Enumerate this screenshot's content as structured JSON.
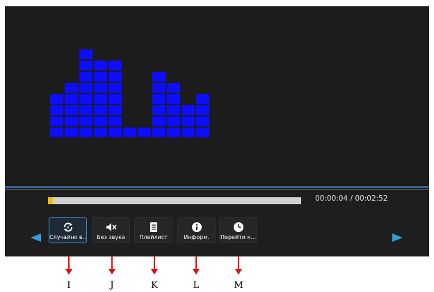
{
  "player": {
    "progress_fraction": 0.02,
    "time_text": "00:00:04 / 00:02:52",
    "equalizer_levels": [
      4,
      5,
      8,
      7,
      7,
      1,
      1,
      6,
      5,
      3,
      4
    ],
    "equalizer_color": "#0d0dff"
  },
  "buttons": [
    {
      "label": "Случайно в...",
      "icon": "shuffle-icon",
      "active": true
    },
    {
      "label": "Без звука",
      "icon": "mute-icon",
      "active": false
    },
    {
      "label": "Плейлист",
      "icon": "playlist-icon",
      "active": false
    },
    {
      "label": "Информ.",
      "icon": "info-icon",
      "active": false
    },
    {
      "label": "Перейти к...",
      "icon": "clock-icon",
      "active": false
    }
  ],
  "nav": {
    "left_icon": "left-arrow-icon",
    "right_icon": "right-arrow-icon",
    "color": "#2f9fd9"
  },
  "callouts": [
    "I",
    "J",
    "K",
    "L",
    "M"
  ]
}
